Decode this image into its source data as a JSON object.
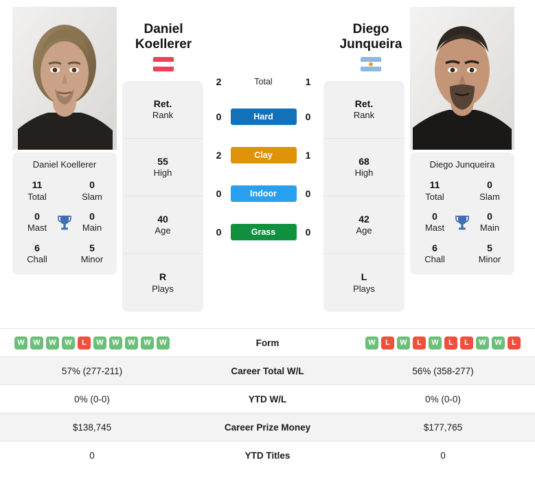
{
  "players": {
    "left": {
      "first_name": "Daniel",
      "last_name": "Koellerer",
      "full_name": "Daniel Koellerer",
      "country": "Austria",
      "flag_icon": "flag-austria",
      "stats": [
        {
          "value": "Ret.",
          "label": "Rank"
        },
        {
          "value": "55",
          "label": "High"
        },
        {
          "value": "40",
          "label": "Age"
        },
        {
          "value": "R",
          "label": "Plays"
        }
      ],
      "titles": {
        "total": "11",
        "total_label": "Total",
        "slam": "0",
        "slam_label": "Slam",
        "mast": "0",
        "mast_label": "Mast",
        "main": "0",
        "main_label": "Main",
        "chall": "6",
        "chall_label": "Chall",
        "minor": "5",
        "minor_label": "Minor"
      },
      "form": [
        "W",
        "W",
        "W",
        "W",
        "L",
        "W",
        "W",
        "W",
        "W",
        "W"
      ],
      "career_total_wl": "57% (277-211)",
      "ytd_wl": "0% (0-0)",
      "career_prize_money": "$138,745",
      "ytd_titles": "0"
    },
    "right": {
      "first_name": "Diego",
      "last_name": "Junqueira",
      "full_name": "Diego Junqueira",
      "country": "Argentina",
      "flag_icon": "flag-argentina",
      "stats": [
        {
          "value": "Ret.",
          "label": "Rank"
        },
        {
          "value": "68",
          "label": "High"
        },
        {
          "value": "42",
          "label": "Age"
        },
        {
          "value": "L",
          "label": "Plays"
        }
      ],
      "titles": {
        "total": "11",
        "total_label": "Total",
        "slam": "0",
        "slam_label": "Slam",
        "mast": "0",
        "mast_label": "Mast",
        "main": "0",
        "main_label": "Main",
        "chall": "6",
        "chall_label": "Chall",
        "minor": "5",
        "minor_label": "Minor"
      },
      "form": [
        "W",
        "L",
        "W",
        "L",
        "W",
        "L",
        "L",
        "W",
        "W",
        "L"
      ],
      "career_total_wl": "56% (358-277)",
      "ytd_wl": "0% (0-0)",
      "career_prize_money": "$177,765",
      "ytd_titles": "0"
    }
  },
  "head_to_head": {
    "total": {
      "label": "Total",
      "left": "2",
      "right": "1"
    },
    "surfaces": [
      {
        "label": "Hard",
        "left": "0",
        "right": "0",
        "color": "#1272b8"
      },
      {
        "label": "Clay",
        "left": "2",
        "right": "1",
        "color": "#e09208"
      },
      {
        "label": "Indoor",
        "left": "0",
        "right": "0",
        "color": "#28a0f0"
      },
      {
        "label": "Grass",
        "left": "0",
        "right": "0",
        "color": "#11913f"
      }
    ]
  },
  "comparison_rows": [
    {
      "label": "Form",
      "type": "form"
    },
    {
      "label": "Career Total W/L",
      "type": "text",
      "key": "career_total_wl"
    },
    {
      "label": "YTD W/L",
      "type": "text",
      "key": "ytd_wl"
    },
    {
      "label": "Career Prize Money",
      "type": "text",
      "key": "career_prize_money"
    },
    {
      "label": "YTD Titles",
      "type": "text",
      "key": "ytd_titles"
    }
  ],
  "colors": {
    "win_badge": "#6cbf7a",
    "loss_badge": "#ef4f3c",
    "trophy": "#3f6fb0",
    "card_bg": "#f1f1f1",
    "row_alt_bg": "#f3f3f3"
  },
  "icons": {
    "trophy": "trophy-icon"
  }
}
